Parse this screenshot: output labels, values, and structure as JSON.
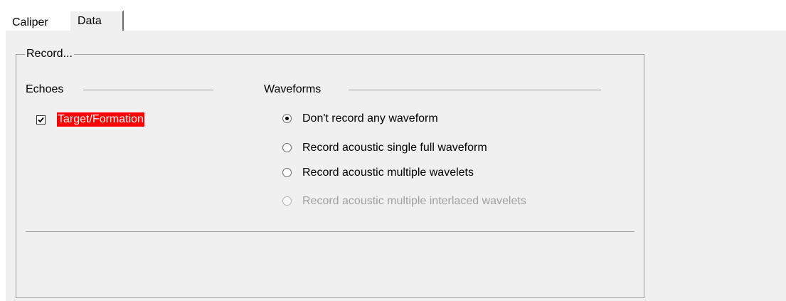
{
  "tabs": [
    {
      "label": "Caliper",
      "active": false
    },
    {
      "label": "Data",
      "active": true
    }
  ],
  "record_group": {
    "legend": "Record...",
    "echoes": {
      "header": "Echoes",
      "checkbox": {
        "label": "Target/Formation",
        "checked": true,
        "highlight_color": "#ff0000"
      }
    },
    "waveforms": {
      "header": "Waveforms",
      "options": [
        {
          "label": "Don't record any waveform",
          "selected": true,
          "enabled": true
        },
        {
          "label": "Record acoustic single full waveform",
          "selected": false,
          "enabled": true
        },
        {
          "label": "Record acoustic multiple wavelets",
          "selected": false,
          "enabled": true
        },
        {
          "label": "Record acoustic multiple interlaced wavelets",
          "selected": false,
          "enabled": false
        }
      ]
    }
  }
}
